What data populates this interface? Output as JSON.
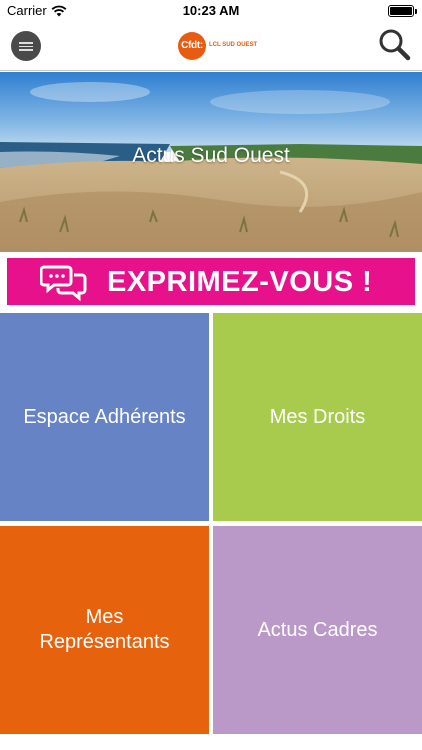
{
  "status_bar": {
    "carrier": "Carrier",
    "time": "10:23 AM"
  },
  "nav": {
    "logo_mark": "Cfdt:",
    "logo_text": "LCL SUD OUEST",
    "icons": [
      "menu-icon",
      "search-icon"
    ],
    "colors": {
      "brand_orange": "#e85c12"
    }
  },
  "hero": {
    "title": "Actus Sud Ouest"
  },
  "banner": {
    "label": "EXPRIMEZ-VOUS !",
    "icon": "speech-bubbles-icon",
    "color": "#e6118b"
  },
  "tiles": [
    {
      "label": "Espace Adhérents",
      "color": "#6683c5"
    },
    {
      "label": "Mes Droits",
      "color": "#a8cb4d"
    },
    {
      "label": "Mes Représentants",
      "color": "#e6620d"
    },
    {
      "label": "Actus Cadres",
      "color": "#ba99c8"
    }
  ]
}
